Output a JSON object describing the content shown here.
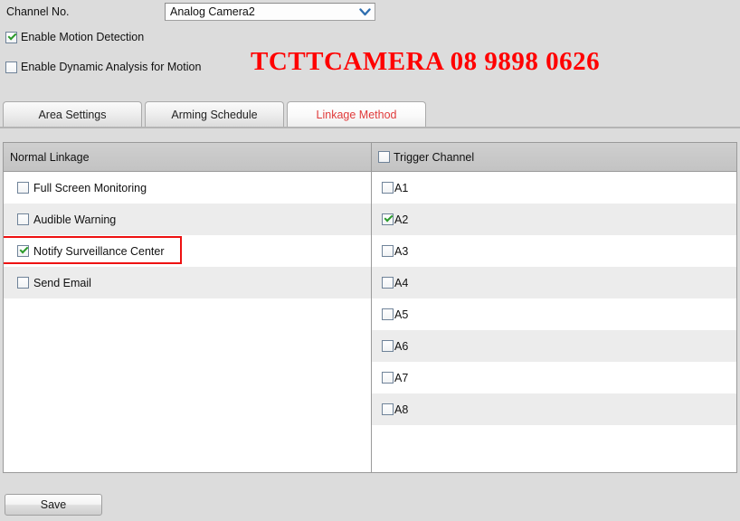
{
  "form": {
    "channel_label": "Channel No.",
    "channel_select": {
      "value": "Analog Camera2",
      "arrow_icon": "chevron-down-icon"
    },
    "enable_motion_detection": {
      "label": "Enable Motion Detection",
      "checked": true
    },
    "enable_dynamic_analysis": {
      "label": "Enable Dynamic Analysis for Motion",
      "checked": false
    }
  },
  "watermark": {
    "text": "TCTTCAMERA 08 9898 0626",
    "color": "#ff0000"
  },
  "tabs": [
    {
      "label": "Area Settings",
      "active": false
    },
    {
      "label": "Arming Schedule",
      "active": false
    },
    {
      "label": "Linkage Method",
      "active": true
    }
  ],
  "table": {
    "headers": {
      "left": "Normal Linkage",
      "right": "Trigger Channel",
      "right_checkbox_checked": false
    },
    "normal_linkage": [
      {
        "label": "Full Screen Monitoring",
        "checked": false,
        "highlighted": false
      },
      {
        "label": "Audible Warning",
        "checked": false,
        "highlighted": false
      },
      {
        "label": "Notify Surveillance Center",
        "checked": true,
        "highlighted": true
      },
      {
        "label": "Send Email",
        "checked": false,
        "highlighted": false
      }
    ],
    "trigger_channel": [
      {
        "label": "A1",
        "checked": false
      },
      {
        "label": "A2",
        "checked": true
      },
      {
        "label": "A3",
        "checked": false
      },
      {
        "label": "A4",
        "checked": false
      },
      {
        "label": "A5",
        "checked": false
      },
      {
        "label": "A6",
        "checked": false
      },
      {
        "label": "A7",
        "checked": false
      },
      {
        "label": "A8",
        "checked": false
      }
    ]
  },
  "footer": {
    "save_label": "Save"
  },
  "colors": {
    "background": "#dcdcdc",
    "header_row": "#c8c8c8",
    "active_tab_text": "#e03a3a",
    "highlight_border": "#ee1111",
    "check_mark": "#2b9b2b"
  }
}
